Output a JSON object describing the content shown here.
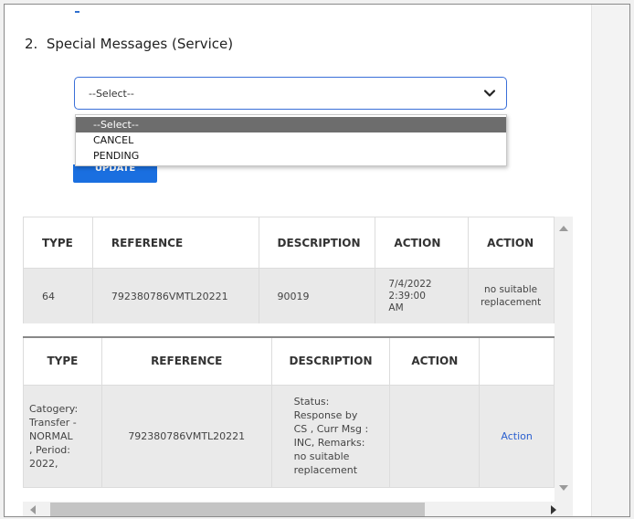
{
  "section": {
    "number": "2.",
    "title": "Special Messages (Service)"
  },
  "select": {
    "value": "--Select--",
    "options": [
      "--Select--",
      "CANCEL",
      "PENDING"
    ],
    "chevron_icon": "chevron-down-icon"
  },
  "update_button": {
    "label": "UPDATE"
  },
  "table1": {
    "headers": [
      "TYPE",
      "REFERENCE",
      "DESCRIPTION",
      "ACTION",
      "ACTION"
    ],
    "row": {
      "type": "64",
      "reference": "792380786VMTL20221",
      "description": "90019",
      "action_date": "7/4/2022",
      "action_time": "2:39:00",
      "action_ampm": "AM",
      "action2_line1": "no suitable",
      "action2_line2": "replacement"
    }
  },
  "table2": {
    "headers": [
      "TYPE",
      "REFERENCE",
      "DESCRIPTION",
      "ACTION"
    ],
    "row": {
      "type_lines": [
        "Catogery:",
        "Transfer -",
        "NORMAL",
        ", Period:",
        "2022,"
      ],
      "reference": "792380786VMTL20221",
      "description_lines": [
        "Status:",
        "Response by",
        "CS , Curr Msg :",
        "INC, Remarks:",
        "no suitable",
        "replacement"
      ],
      "action_link": "Action"
    }
  },
  "colors": {
    "accent": "#1a6fe0",
    "link": "#2a5fcf",
    "selected_option": "#6d6d6d"
  }
}
